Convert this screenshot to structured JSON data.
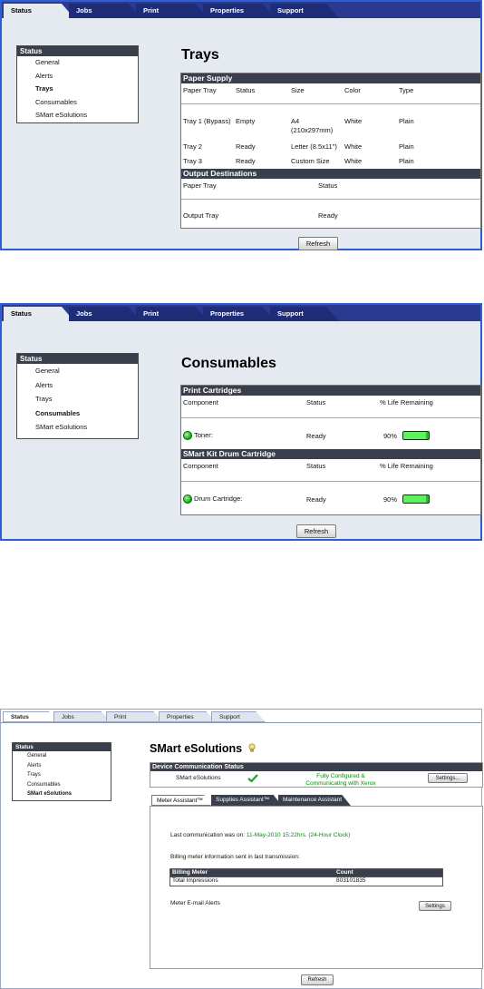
{
  "tabs": [
    "Status",
    "Jobs",
    "Print",
    "Properties",
    "Support"
  ],
  "sidebar": {
    "heading": "Status",
    "items": [
      "General",
      "Alerts",
      "Trays",
      "Consumables",
      "SMart eSolutions"
    ]
  },
  "trays": {
    "title": "Trays",
    "paper_supply": {
      "heading": "Paper Supply",
      "columns": [
        "Paper Tray",
        "Status",
        "Size",
        "Color",
        "Type"
      ],
      "rows": [
        {
          "tray": "Tray 1 (Bypass)",
          "status": "Empty",
          "size": "A4",
          "size2": "(210x297mm)",
          "color": "White",
          "type": "Plain"
        },
        {
          "tray": "Tray 2",
          "status": "Ready",
          "size": "Letter (8.5x11\")",
          "color": "White",
          "type": "Plain"
        },
        {
          "tray": "Tray 3",
          "status": "Ready",
          "size": "Custom Size",
          "color": "White",
          "type": "Plain"
        }
      ]
    },
    "output": {
      "heading": "Output Destinations",
      "columns": [
        "Paper Tray",
        "Status"
      ],
      "rows": [
        {
          "tray": "Output Tray",
          "status": "Ready"
        }
      ]
    },
    "refresh": "Refresh"
  },
  "consumables": {
    "title": "Consumables",
    "print_cartridges": {
      "heading": "Print Cartridges",
      "columns": [
        "Component",
        "Status",
        "% Life Remaining"
      ],
      "row": {
        "component": "Toner:",
        "status": "Ready",
        "life": "90%",
        "life_value": 90
      }
    },
    "drum": {
      "heading": "SMart Kit Drum Cartridge",
      "columns": [
        "Component",
        "Status",
        "% Life Remaining"
      ],
      "row": {
        "component": "Drum Cartridge:",
        "status": "Ready",
        "life": "90%",
        "life_value": 90
      }
    },
    "refresh": "Refresh"
  },
  "esolutions": {
    "title": "SMart eSolutions",
    "dcs": {
      "heading": "Device Communication Status",
      "label": "SMart eSolutions",
      "status_line1": "Fully Configured &",
      "status_line2": "Communicating with Xerox",
      "settings": "Settings..."
    },
    "subtabs": [
      "Meter Assistant™",
      "Supplies Assistant™",
      "Maintenance Assistant"
    ],
    "last_comm_prefix": "Last communication was on: ",
    "last_comm_value": "11-May-2010 15:22hrs. (24-Hour Clock)",
    "billing_note": "Billing meter information sent in last transmission:",
    "billing_table": {
      "columns": [
        "Billing Meter",
        "Count"
      ],
      "rows": [
        {
          "meter": "Total Impressions",
          "count": "803101835"
        }
      ]
    },
    "email_alerts": "Meter E-mail Alerts",
    "email_settings": "Settings",
    "refresh": "Refresh"
  },
  "colors": {
    "accent_blue": "#2d5fd0",
    "tab_navy": "#1f2c78",
    "section_dark": "#3a3f4e",
    "panel_bg": "#e5eaf0",
    "gauge_green": "#5df25d",
    "status_green": "#0a8a0a"
  },
  "icons": [
    "green-status-light-icon",
    "check-mark-icon",
    "help-lightbulb-icon"
  ]
}
